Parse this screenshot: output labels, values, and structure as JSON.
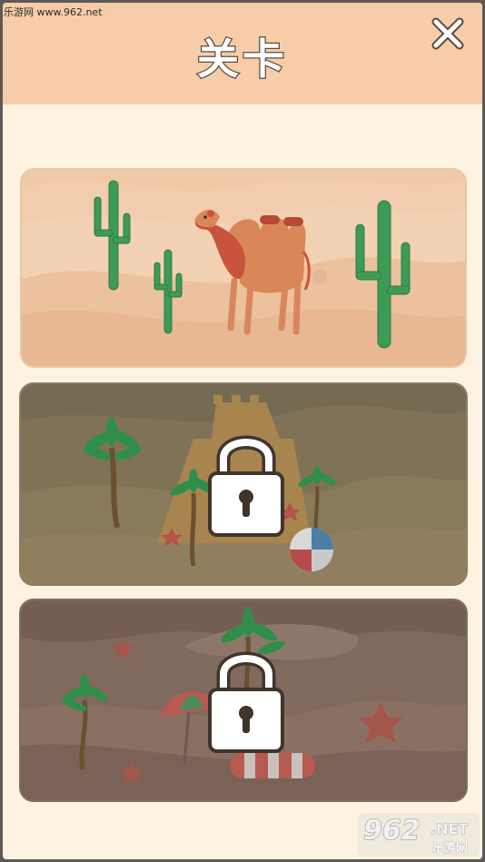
{
  "watermark": {
    "site": "乐游网 www.962.net"
  },
  "header": {
    "title": "关卡",
    "close_icon": "close-icon"
  },
  "levels": [
    {
      "theme": "desert-camel",
      "locked": false
    },
    {
      "theme": "sand-castle-beach",
      "locked": true
    },
    {
      "theme": "beach-umbrella",
      "locked": true
    }
  ],
  "badge": {
    "num": "962",
    "net": ".NET",
    "sub": "乐游网"
  },
  "colors": {
    "header_bg": "#f6cda8",
    "page_bg": "#fdf3e0",
    "cactus": "#3e9b57",
    "camel": "#d27b4c"
  }
}
